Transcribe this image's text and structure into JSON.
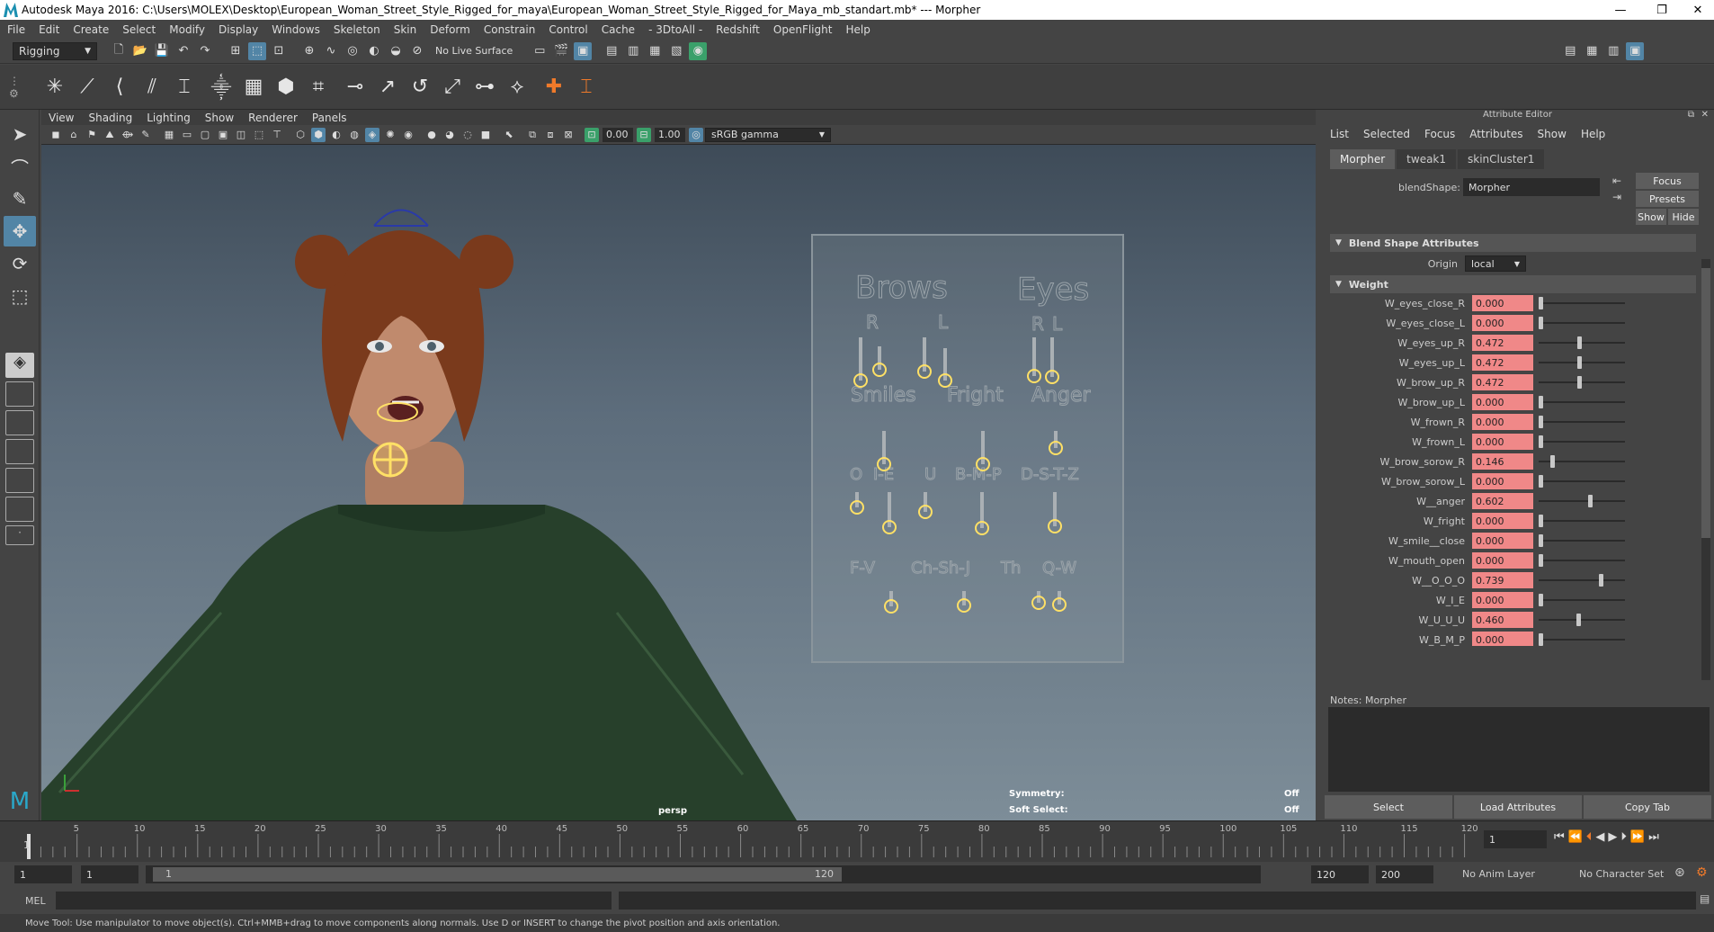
{
  "window": {
    "title": "Autodesk Maya 2016: C:\\Users\\MOLEX\\Desktop\\European_Woman_Street_Style_Rigged_for_maya\\European_Woman_Street_Style_Rigged_for_Maya_mb_standart.mb*   ---   Morpher",
    "minimize": "—",
    "restore": "❐",
    "close": "✕"
  },
  "menubar": [
    "File",
    "Edit",
    "Create",
    "Select",
    "Modify",
    "Display",
    "Windows",
    "Skeleton",
    "Skin",
    "Deform",
    "Constrain",
    "Control",
    "Cache",
    "- 3DtoAll -",
    "Redshift",
    "OpenFlight",
    "Help"
  ],
  "status": {
    "menuset": "Rigging",
    "live_surface": "No Live Surface"
  },
  "viewport": {
    "menu": [
      "View",
      "Shading",
      "Lighting",
      "Show",
      "Renderer",
      "Panels"
    ],
    "near_value": "0.00",
    "far_value": "1.00",
    "color_space": "sRGB gamma",
    "camera_label": "persp",
    "hud": {
      "symmetry_label": "Symmetry:",
      "symmetry_value": "Off",
      "soft_label": "Soft Select:",
      "soft_value": "Off"
    },
    "face_board": {
      "labels": [
        "Brows",
        "Eyes",
        "R",
        "L",
        "R",
        "L",
        "Smiles",
        "Fright",
        "Anger",
        "O",
        "I-E",
        "U",
        "B-M-P",
        "D-S-T-Z",
        "F-V",
        "Ch-Sh-J",
        "Th",
        "Q-W"
      ]
    }
  },
  "attribute_editor": {
    "header": "Attribute Editor",
    "menu": [
      "List",
      "Selected",
      "Focus",
      "Attributes",
      "Show",
      "Help"
    ],
    "tabs": [
      "Morpher",
      "tweak1",
      "skinCluster1"
    ],
    "blendshape_label": "blendShape:",
    "blendshape_value": "Morpher",
    "side_buttons": {
      "focus": "Focus",
      "presets": "Presets",
      "show": "Show",
      "hide": "Hide"
    },
    "section_blend": "Blend Shape Attributes",
    "origin_label": "Origin",
    "origin_value": "local",
    "section_weight": "Weight",
    "weights": [
      {
        "name": "W_eyes_close_R",
        "value": "0.000",
        "v": 0.0
      },
      {
        "name": "W_eyes_close_L",
        "value": "0.000",
        "v": 0.0
      },
      {
        "name": "W_eyes_up_R",
        "value": "0.472",
        "v": 0.472
      },
      {
        "name": "W_eyes_up_L",
        "value": "0.472",
        "v": 0.472
      },
      {
        "name": "W_brow_up_R",
        "value": "0.472",
        "v": 0.472
      },
      {
        "name": "W_brow_up_L",
        "value": "0.000",
        "v": 0.0
      },
      {
        "name": "W_frown_R",
        "value": "0.000",
        "v": 0.0
      },
      {
        "name": "W_frown_L",
        "value": "0.000",
        "v": 0.0
      },
      {
        "name": "W_brow_sorow_R",
        "value": "0.146",
        "v": 0.146
      },
      {
        "name": "W_brow_sorow_L",
        "value": "0.000",
        "v": 0.0
      },
      {
        "name": "W__anger",
        "value": "0.602",
        "v": 0.602
      },
      {
        "name": "W_fright",
        "value": "0.000",
        "v": 0.0
      },
      {
        "name": "W_smile__close",
        "value": "0.000",
        "v": 0.0
      },
      {
        "name": "W_mouth_open",
        "value": "0.000",
        "v": 0.0
      },
      {
        "name": "W__O_O_O",
        "value": "0.739",
        "v": 0.739
      },
      {
        "name": "W_I_E",
        "value": "0.000",
        "v": 0.0
      },
      {
        "name": "W_U_U_U",
        "value": "0.460",
        "v": 0.46
      },
      {
        "name": "W_B_M_P",
        "value": "0.000",
        "v": 0.0
      }
    ],
    "notes_label": "Notes:  Morpher",
    "bottom_buttons": [
      "Select",
      "Load Attributes",
      "Copy Tab"
    ]
  },
  "timeline": {
    "ticks": [
      "5",
      "10",
      "15",
      "20",
      "25",
      "30",
      "35",
      "40",
      "45",
      "50",
      "55",
      "60",
      "65",
      "70",
      "75",
      "80",
      "85",
      "90",
      "95",
      "100",
      "105",
      "110",
      "115",
      "120"
    ],
    "start_label": "1",
    "current_frame": "1"
  },
  "range": {
    "start": "1",
    "anim_start": "1",
    "slider_start": "1",
    "slider_end": "120",
    "anim_end": "120",
    "end": "200",
    "anim_layer": "No Anim Layer",
    "char_set": "No Character Set"
  },
  "command": {
    "language": "MEL"
  },
  "help_line": "Move Tool: Use manipulator to move object(s). Ctrl+MMB+drag to move components along normals. Use D or INSERT to change the pivot position and axis orientation."
}
